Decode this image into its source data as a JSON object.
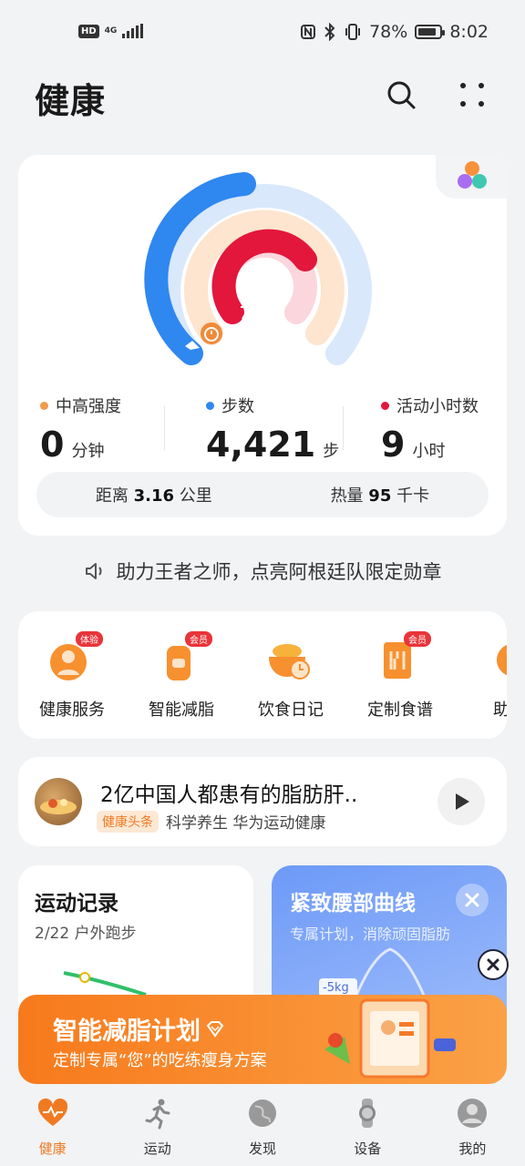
{
  "status_bar": {
    "hd": "HD",
    "network": "4G",
    "battery": "78%",
    "time": "8:02"
  },
  "header": {
    "title": "健康"
  },
  "activity": {
    "metrics": [
      {
        "label": "中高强度",
        "value": "0",
        "unit": "分钟",
        "color": "#f09a4c"
      },
      {
        "label": "步数",
        "value": "4,421",
        "unit": "步",
        "color": "#2f87f0"
      },
      {
        "label": "活动小时数",
        "value": "9",
        "unit": "小时",
        "color": "#e3163c"
      }
    ],
    "distance_label": "距离",
    "distance_value": "3.16",
    "distance_unit": "公里",
    "calorie_label": "热量",
    "calorie_value": "95",
    "calorie_unit": "千卡",
    "ring_progress": {
      "steps": 0.52,
      "intensity": 0.0,
      "hours": 0.75
    }
  },
  "banner": {
    "text": "助力王者之师，点亮阿根廷队限定勋章"
  },
  "services": [
    {
      "label": "健康服务",
      "tag": "体验"
    },
    {
      "label": "智能减脂",
      "tag": "会员"
    },
    {
      "label": "饮食日记",
      "tag": ""
    },
    {
      "label": "定制食谱",
      "tag": "会员"
    },
    {
      "label": "助眠",
      "tag": ""
    }
  ],
  "news": {
    "title": "2亿中国人都患有的脂肪肝..",
    "tag": "健康头条",
    "meta": "科学养生 华为运动健康"
  },
  "record": {
    "title": "运动记录",
    "subtitle": "2/22 户外跑步"
  },
  "plan": {
    "title": "紧致腰部曲线",
    "subtitle": "专属计划，消除顽固脂肪",
    "badge": "-5kg"
  },
  "promo": {
    "title": "智能减脂计划",
    "subtitle": "定制专属“您”的吃练瘦身方案"
  },
  "tabs": [
    {
      "label": "健康",
      "icon": "heart-pulse-icon",
      "active": true
    },
    {
      "label": "运动",
      "icon": "runner-icon",
      "active": false
    },
    {
      "label": "发现",
      "icon": "globe-icon",
      "active": false
    },
    {
      "label": "设备",
      "icon": "watch-icon",
      "active": false
    },
    {
      "label": "我的",
      "icon": "user-icon",
      "active": false
    }
  ],
  "colors": {
    "accent": "#f07a23",
    "steps_ring": "#2f87f0",
    "intensity_ring": "#f09a4c",
    "hours_ring": "#e3163c"
  }
}
